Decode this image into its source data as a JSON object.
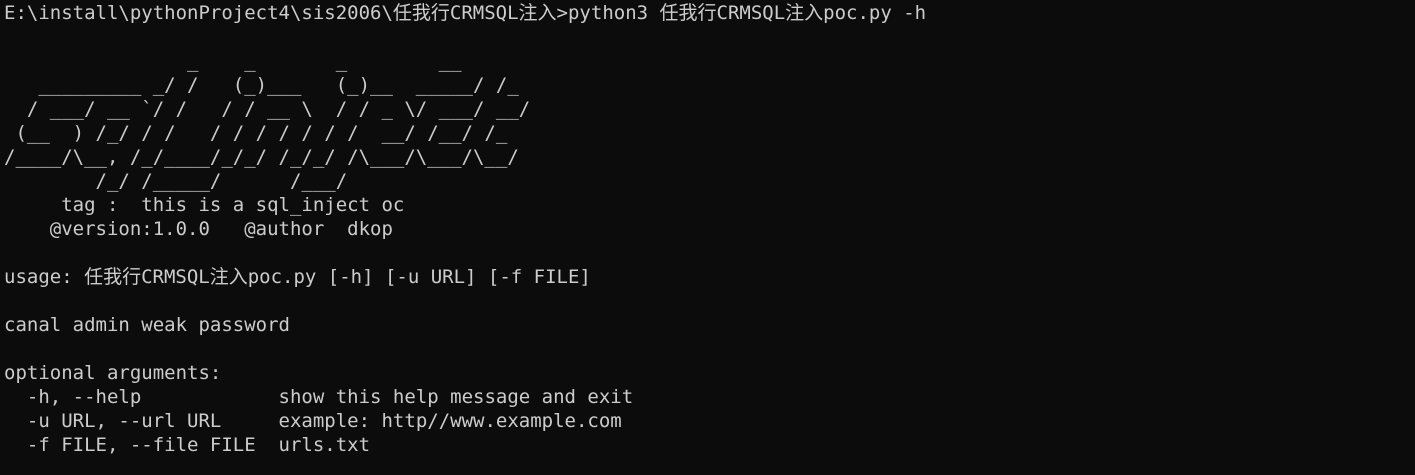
{
  "terminal": {
    "prompt_line": "E:\\install\\pythonProject4\\sis2006\\任我行CRMSQL注入>python3 任我行CRMSQL注入poc.py -h",
    "banner": [
      "                _    _       _        __",
      "   _________ _/ /   (_)___   (_)__  _____/ /_",
      "  / ___/ __ `/ /   / / __ \\  / / _ \\/ ___/ __/",
      " (__  ) /_/ / /   / / / / / / /  __/ /__/ /_",
      "/____/\\__, /_/____/_/_/ /_/_/ /\\___/\\___/\\__/",
      "        /_/ /_____/      /___/"
    ],
    "tag_line": "     tag :  this is a sql_inject oc",
    "version_line": "    @version:1.0.0   @author  dkop",
    "usage_line": "usage: 任我行CRMSQL注入poc.py [-h] [-u URL] [-f FILE]",
    "description_line": "canal admin weak password",
    "optional_header": "optional arguments:",
    "options": [
      {
        "flag": "  -h, --help            ",
        "help": "show this help message and exit"
      },
      {
        "flag": "  -u URL, --url URL     ",
        "help": "example: http//www.example.com"
      },
      {
        "flag": "  -f FILE, --file FILE  ",
        "help": "urls.txt"
      }
    ]
  },
  "colors": {
    "background": "#0c0c0c",
    "foreground": "#cccccc"
  }
}
